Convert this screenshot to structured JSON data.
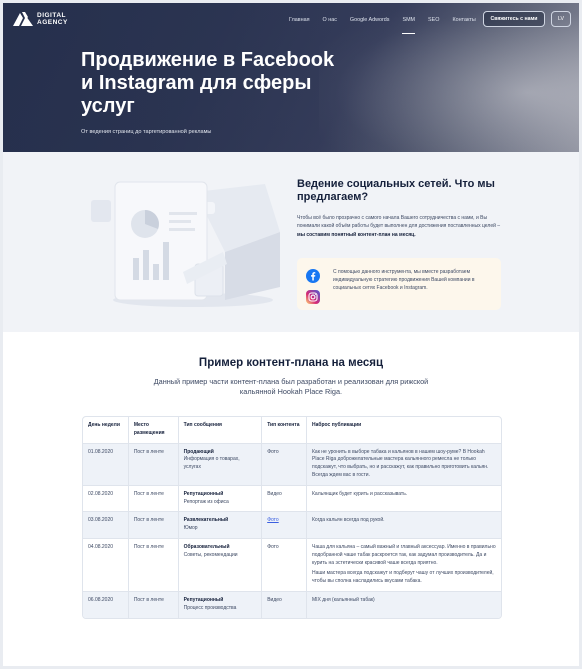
{
  "header": {
    "logo_line1": "DIGITAL",
    "logo_line2": "AGENCY",
    "nav": [
      {
        "label": "Главная",
        "active": false
      },
      {
        "label": "О нас",
        "active": false
      },
      {
        "label": "Google Adwords",
        "active": false
      },
      {
        "label": "SMM",
        "active": true
      },
      {
        "label": "SEO",
        "active": false
      },
      {
        "label": "Контакты",
        "active": false
      }
    ],
    "contact_button": "Свяжитесь с нами",
    "lang_button": "LV"
  },
  "hero": {
    "title": "Продвижение в Facebook и Instagram для сферы услуг",
    "subtitle": "От ведения страниц до таргетированной рекламы"
  },
  "services": {
    "title": "Ведение социальных сетей. Что мы предлагаем?",
    "text_plain": "Чтобы всё было прозрачно с самого начала Вашего сотрудничества с нами, и Вы понимали какой объём работы будет выполнен для достижения поставленных целей – ",
    "text_bold": "мы составим понятный контент-план на месяц.",
    "card_text": "С помощью данного инструмента, мы вместе разработаем индивидуальную стратегию продвижения Вашей компании в социальных сетях Facebook и Instagram.",
    "icons": [
      "facebook-icon",
      "instagram-icon"
    ],
    "colors": {
      "facebook": "#1877f2",
      "instagram": "#e1306c",
      "card_bg": "#fdf7ec"
    }
  },
  "plan": {
    "title": "Пример контент-плана на месяц",
    "subtitle": "Данный пример части контент-плана был разработан и реализован для рижской кальянной Hookah Place Riga.",
    "headers": [
      "День недели",
      "Место размещения",
      "Тип сообщения",
      "Тип контента",
      "Наброс публикации"
    ],
    "rows": [
      {
        "date": "01.08.2020",
        "place": "Пост в ленте",
        "type_title": "Продающий",
        "type_desc": "Информация о товарах, услугах",
        "content": "Фото",
        "content_link": false,
        "draft": "Как не уронить в выборе табака и кальянов в нашем шоу-руме? В Hookah Place Riga доброжелательные мастера кальянного ремесла не только подскажут, что выбрать, но и расскажут, как правильно приготовить кальян. Всегда ждем вас в гости.",
        "draft2": ""
      },
      {
        "date": "02.08.2020",
        "place": "Пост в ленте",
        "type_title": "Репутационный",
        "type_desc": "Репортаж из офиса",
        "content": "Видео",
        "content_link": false,
        "draft": "Кальянщик будет курить и рассказывать.",
        "draft2": ""
      },
      {
        "date": "03.08.2020",
        "place": "Пост в ленте",
        "type_title": "Развлекательный",
        "type_desc": "Юмор",
        "content": "Фото",
        "content_link": true,
        "draft": "Когда кальян всегда под рукой.",
        "draft2": ""
      },
      {
        "date": "04.08.2020",
        "place": "Пост в ленте",
        "type_title": "Образовательный",
        "type_desc": "Советы, рекомендации",
        "content": "Фото",
        "content_link": false,
        "draft": "Чаша для кальяна – самый важный и главный аксессуар. Именно в правильно подобранной чаше табак раскроется так, как задумал производитель. Да и курить на эстетически красивой чаше всегда приятно.",
        "draft2": "Наши мастера всегда подскажут и подберут чашу от лучших производителей, чтобы вы сполна насладились вкусами табака."
      },
      {
        "date": "06.08.2020",
        "place": "Пост в ленте",
        "type_title": "Репутационный",
        "type_desc": "Процесс производства",
        "content": "Видео",
        "content_link": false,
        "draft": "MIX дня (кальянный табак)",
        "draft2": ""
      }
    ]
  }
}
